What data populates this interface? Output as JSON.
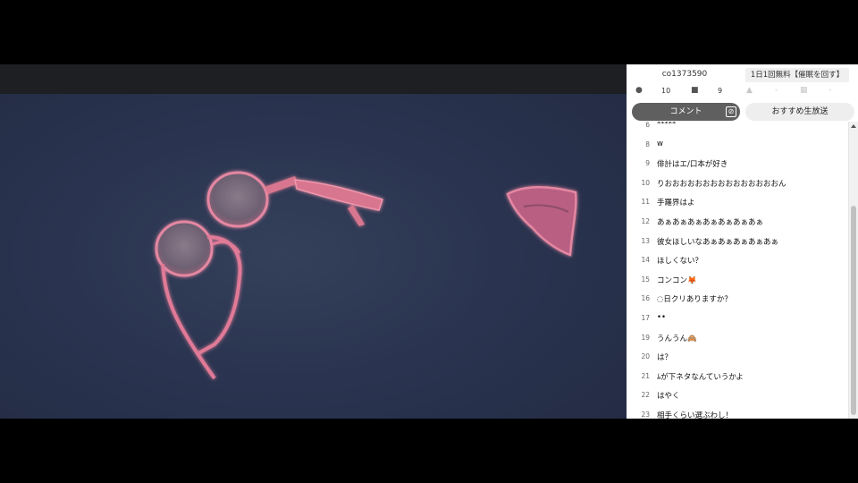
{
  "header": {
    "community_id": "co1373590",
    "notice": "1日1回無料【催眠を回す】"
  },
  "stats": {
    "viewers_icon": "person-icon",
    "viewers": "10",
    "comments_icon": "speech-bubble-icon",
    "comments": "9"
  },
  "tabs": {
    "comment_label": "コメント",
    "comment_icon": "no-entry-icon",
    "recommend_label": "おすすめ生放送"
  },
  "comments": [
    {
      "num": "6",
      "text": "*****"
    },
    {
      "num": "8",
      "text": "w"
    },
    {
      "num": "9",
      "text": "俳計はエ/口本が好き"
    },
    {
      "num": "10",
      "text": "りおおおおおおおおおおおおおおおん"
    },
    {
      "num": "11",
      "text": "手羅界はよ"
    },
    {
      "num": "12",
      "text": "あぁあぁあぁあぁあぁあぁあぁ"
    },
    {
      "num": "13",
      "text": "彼女ほしいなあぁあぁあぁあぁあぁ"
    },
    {
      "num": "14",
      "text": "ほしくない？"
    },
    {
      "num": "15",
      "text": "コンコン🦊"
    },
    {
      "num": "16",
      "text": "◌日クリありますか？"
    },
    {
      "num": "17",
      "text": "••"
    },
    {
      "num": "19",
      "text": "うんうん🙈"
    },
    {
      "num": "20",
      "text": "は？"
    },
    {
      "num": "21",
      "text": "ﾑが下ネタなんていうかよ"
    },
    {
      "num": "22",
      "text": "はやく"
    },
    {
      "num": "23",
      "text": "相手くらい選ぶわし！"
    }
  ],
  "colors": {
    "video_bg": "#2a3450",
    "pink_glow": "#e9809e",
    "tab_active": "#5f5f5f"
  }
}
